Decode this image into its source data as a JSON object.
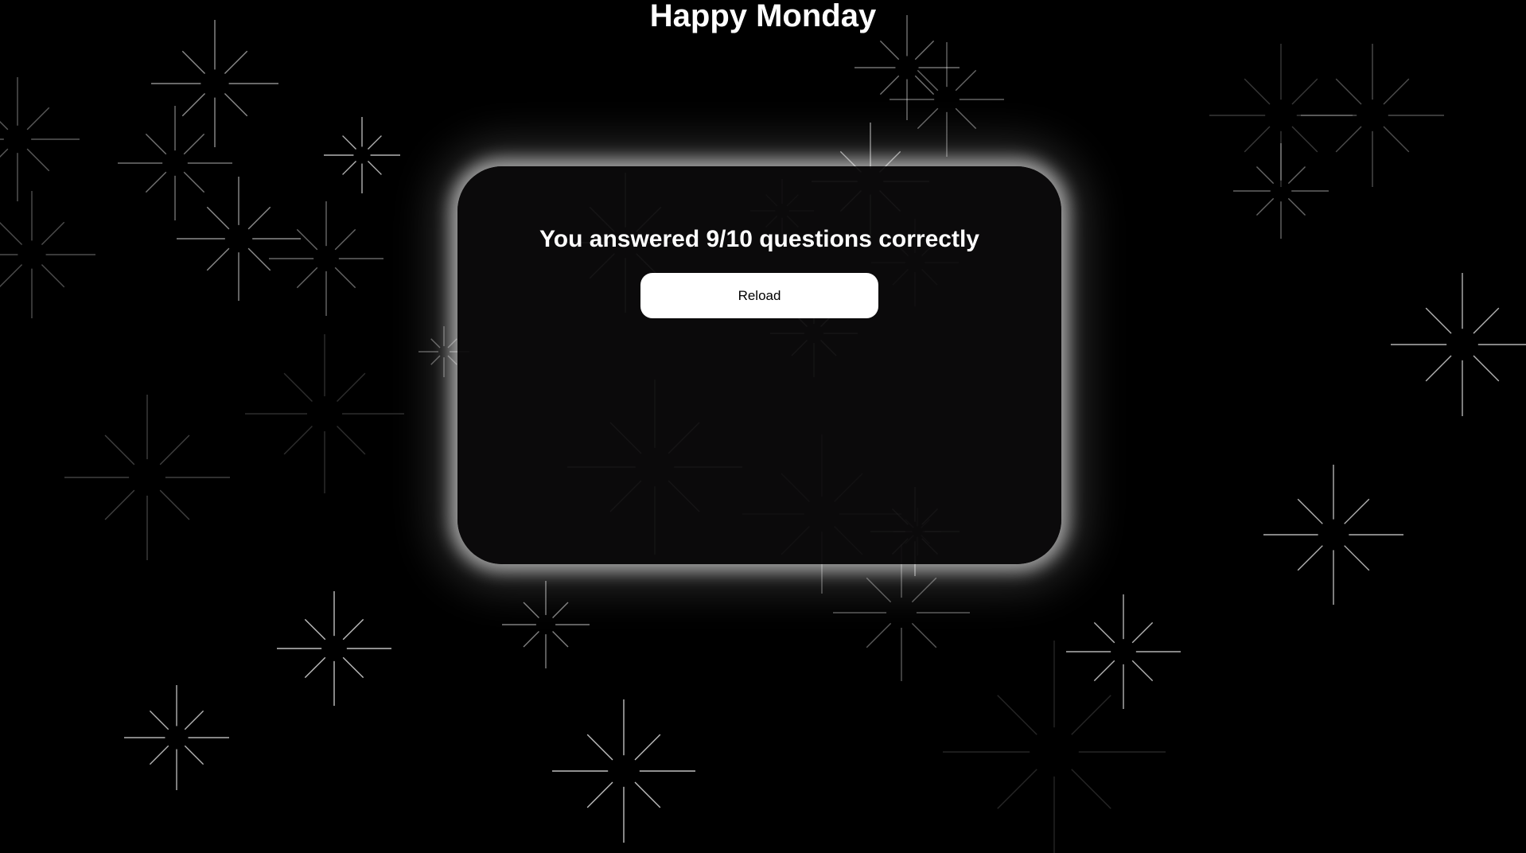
{
  "header": {
    "title": "Happy Monday"
  },
  "result": {
    "message": "You answered 9/10 questions correctly",
    "reload_label": "Reload"
  },
  "background": {
    "color": "#000000",
    "card_color": "#0c0b0c",
    "sparkle_color": "#ffffff",
    "decoration": "sparkle-icons"
  }
}
